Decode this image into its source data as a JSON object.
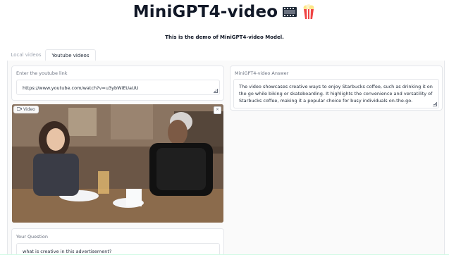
{
  "header": {
    "title": "MiniGPT4-video",
    "subtitle": "This is the demo of MiniGPT4-video Model."
  },
  "tabs": [
    {
      "label": "Local videos",
      "active": false
    },
    {
      "label": "Youtube videos",
      "active": true
    }
  ],
  "youtube_link": {
    "label": "Enter the youtube link",
    "value": "https://www.youtube.com/watch?v=u3ybWiEUaUU"
  },
  "video": {
    "tag_label": "Video",
    "close_label": "×"
  },
  "answer": {
    "label": "MiniGPT4-video Answer",
    "value": "The video showcases creative ways to enjoy Starbucks coffee, such as drinking it on the go while biking or skateboarding. It highlights the convenience and versatility of Starbucks coffee, making it a popular choice for busy individuals on-the-go."
  },
  "question": {
    "label": "Your Question",
    "value": "what is creative in this advertisement?"
  },
  "colors": {
    "accent": "#f97316",
    "border": "#e5e7eb"
  },
  "icons": [
    "film-icon",
    "popcorn-icon",
    "video-camera-icon",
    "close-icon",
    "resize-handle-icon"
  ]
}
